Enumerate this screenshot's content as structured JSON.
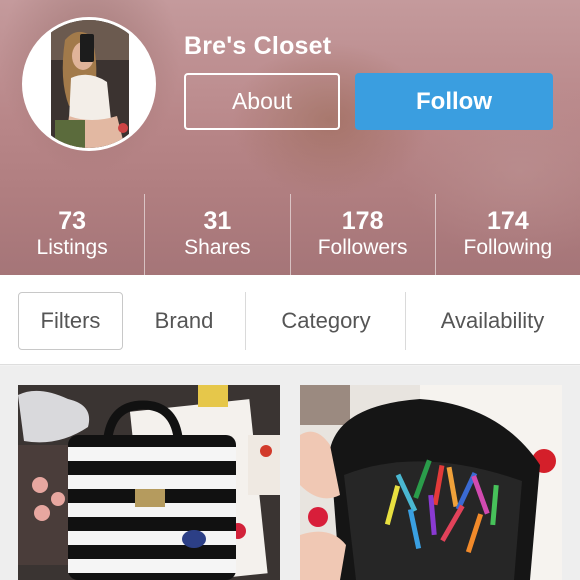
{
  "profile": {
    "shop_name": "Bre's Closet",
    "about_label": "About",
    "follow_label": "Follow"
  },
  "stats": [
    {
      "value": "73",
      "label": "Listings"
    },
    {
      "value": "31",
      "label": "Shares"
    },
    {
      "value": "178",
      "label": "Followers"
    },
    {
      "value": "174",
      "label": "Following"
    }
  ],
  "filters": {
    "filters_label": "Filters",
    "brand_label": "Brand",
    "category_label": "Category",
    "availability_label": "Availability"
  },
  "colors": {
    "follow_button": "#3a9ee0",
    "header_tint": "#b88688"
  }
}
